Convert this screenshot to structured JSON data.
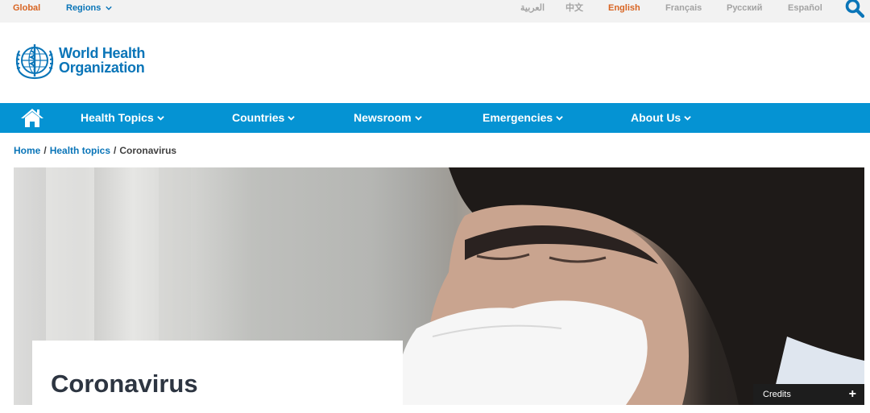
{
  "topbar": {
    "global_label": "Global",
    "regions_label": "Regions",
    "languages": [
      "العربية",
      "中文",
      "English",
      "Français",
      "Русский",
      "Español"
    ],
    "active_language": "English"
  },
  "logo": {
    "line1": "World Health",
    "line2": "Organization"
  },
  "nav": {
    "items": [
      {
        "label": "Health Topics"
      },
      {
        "label": "Countries"
      },
      {
        "label": "Newsroom"
      },
      {
        "label": "Emergencies"
      },
      {
        "label": "About Us"
      }
    ]
  },
  "breadcrumb": {
    "home": "Home",
    "parent": "Health topics",
    "current": "Coronavirus",
    "separator": "/"
  },
  "hero": {
    "title": "Coronavirus",
    "credits_label": "Credits",
    "credits_toggle": "+"
  },
  "colors": {
    "brand_blue": "#0a75b8",
    "nav_blue": "#0593d3",
    "accent_orange": "#d86422"
  }
}
